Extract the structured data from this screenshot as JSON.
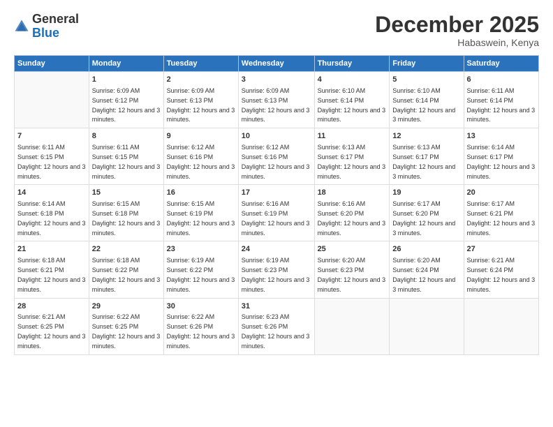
{
  "header": {
    "logo_general": "General",
    "logo_blue": "Blue",
    "month_title": "December 2025",
    "location": "Habaswein, Kenya"
  },
  "days_of_week": [
    "Sunday",
    "Monday",
    "Tuesday",
    "Wednesday",
    "Thursday",
    "Friday",
    "Saturday"
  ],
  "weeks": [
    [
      {
        "day": "",
        "sunrise": "",
        "sunset": "",
        "daylight": ""
      },
      {
        "day": "1",
        "sunrise": "Sunrise: 6:09 AM",
        "sunset": "Sunset: 6:12 PM",
        "daylight": "Daylight: 12 hours and 3 minutes."
      },
      {
        "day": "2",
        "sunrise": "Sunrise: 6:09 AM",
        "sunset": "Sunset: 6:13 PM",
        "daylight": "Daylight: 12 hours and 3 minutes."
      },
      {
        "day": "3",
        "sunrise": "Sunrise: 6:09 AM",
        "sunset": "Sunset: 6:13 PM",
        "daylight": "Daylight: 12 hours and 3 minutes."
      },
      {
        "day": "4",
        "sunrise": "Sunrise: 6:10 AM",
        "sunset": "Sunset: 6:14 PM",
        "daylight": "Daylight: 12 hours and 3 minutes."
      },
      {
        "day": "5",
        "sunrise": "Sunrise: 6:10 AM",
        "sunset": "Sunset: 6:14 PM",
        "daylight": "Daylight: 12 hours and 3 minutes."
      },
      {
        "day": "6",
        "sunrise": "Sunrise: 6:11 AM",
        "sunset": "Sunset: 6:14 PM",
        "daylight": "Daylight: 12 hours and 3 minutes."
      }
    ],
    [
      {
        "day": "7",
        "sunrise": "Sunrise: 6:11 AM",
        "sunset": "Sunset: 6:15 PM",
        "daylight": "Daylight: 12 hours and 3 minutes."
      },
      {
        "day": "8",
        "sunrise": "Sunrise: 6:11 AM",
        "sunset": "Sunset: 6:15 PM",
        "daylight": "Daylight: 12 hours and 3 minutes."
      },
      {
        "day": "9",
        "sunrise": "Sunrise: 6:12 AM",
        "sunset": "Sunset: 6:16 PM",
        "daylight": "Daylight: 12 hours and 3 minutes."
      },
      {
        "day": "10",
        "sunrise": "Sunrise: 6:12 AM",
        "sunset": "Sunset: 6:16 PM",
        "daylight": "Daylight: 12 hours and 3 minutes."
      },
      {
        "day": "11",
        "sunrise": "Sunrise: 6:13 AM",
        "sunset": "Sunset: 6:17 PM",
        "daylight": "Daylight: 12 hours and 3 minutes."
      },
      {
        "day": "12",
        "sunrise": "Sunrise: 6:13 AM",
        "sunset": "Sunset: 6:17 PM",
        "daylight": "Daylight: 12 hours and 3 minutes."
      },
      {
        "day": "13",
        "sunrise": "Sunrise: 6:14 AM",
        "sunset": "Sunset: 6:17 PM",
        "daylight": "Daylight: 12 hours and 3 minutes."
      }
    ],
    [
      {
        "day": "14",
        "sunrise": "Sunrise: 6:14 AM",
        "sunset": "Sunset: 6:18 PM",
        "daylight": "Daylight: 12 hours and 3 minutes."
      },
      {
        "day": "15",
        "sunrise": "Sunrise: 6:15 AM",
        "sunset": "Sunset: 6:18 PM",
        "daylight": "Daylight: 12 hours and 3 minutes."
      },
      {
        "day": "16",
        "sunrise": "Sunrise: 6:15 AM",
        "sunset": "Sunset: 6:19 PM",
        "daylight": "Daylight: 12 hours and 3 minutes."
      },
      {
        "day": "17",
        "sunrise": "Sunrise: 6:16 AM",
        "sunset": "Sunset: 6:19 PM",
        "daylight": "Daylight: 12 hours and 3 minutes."
      },
      {
        "day": "18",
        "sunrise": "Sunrise: 6:16 AM",
        "sunset": "Sunset: 6:20 PM",
        "daylight": "Daylight: 12 hours and 3 minutes."
      },
      {
        "day": "19",
        "sunrise": "Sunrise: 6:17 AM",
        "sunset": "Sunset: 6:20 PM",
        "daylight": "Daylight: 12 hours and 3 minutes."
      },
      {
        "day": "20",
        "sunrise": "Sunrise: 6:17 AM",
        "sunset": "Sunset: 6:21 PM",
        "daylight": "Daylight: 12 hours and 3 minutes."
      }
    ],
    [
      {
        "day": "21",
        "sunrise": "Sunrise: 6:18 AM",
        "sunset": "Sunset: 6:21 PM",
        "daylight": "Daylight: 12 hours and 3 minutes."
      },
      {
        "day": "22",
        "sunrise": "Sunrise: 6:18 AM",
        "sunset": "Sunset: 6:22 PM",
        "daylight": "Daylight: 12 hours and 3 minutes."
      },
      {
        "day": "23",
        "sunrise": "Sunrise: 6:19 AM",
        "sunset": "Sunset: 6:22 PM",
        "daylight": "Daylight: 12 hours and 3 minutes."
      },
      {
        "day": "24",
        "sunrise": "Sunrise: 6:19 AM",
        "sunset": "Sunset: 6:23 PM",
        "daylight": "Daylight: 12 hours and 3 minutes."
      },
      {
        "day": "25",
        "sunrise": "Sunrise: 6:20 AM",
        "sunset": "Sunset: 6:23 PM",
        "daylight": "Daylight: 12 hours and 3 minutes."
      },
      {
        "day": "26",
        "sunrise": "Sunrise: 6:20 AM",
        "sunset": "Sunset: 6:24 PM",
        "daylight": "Daylight: 12 hours and 3 minutes."
      },
      {
        "day": "27",
        "sunrise": "Sunrise: 6:21 AM",
        "sunset": "Sunset: 6:24 PM",
        "daylight": "Daylight: 12 hours and 3 minutes."
      }
    ],
    [
      {
        "day": "28",
        "sunrise": "Sunrise: 6:21 AM",
        "sunset": "Sunset: 6:25 PM",
        "daylight": "Daylight: 12 hours and 3 minutes."
      },
      {
        "day": "29",
        "sunrise": "Sunrise: 6:22 AM",
        "sunset": "Sunset: 6:25 PM",
        "daylight": "Daylight: 12 hours and 3 minutes."
      },
      {
        "day": "30",
        "sunrise": "Sunrise: 6:22 AM",
        "sunset": "Sunset: 6:26 PM",
        "daylight": "Daylight: 12 hours and 3 minutes."
      },
      {
        "day": "31",
        "sunrise": "Sunrise: 6:23 AM",
        "sunset": "Sunset: 6:26 PM",
        "daylight": "Daylight: 12 hours and 3 minutes."
      },
      {
        "day": "",
        "sunrise": "",
        "sunset": "",
        "daylight": ""
      },
      {
        "day": "",
        "sunrise": "",
        "sunset": "",
        "daylight": ""
      },
      {
        "day": "",
        "sunrise": "",
        "sunset": "",
        "daylight": ""
      }
    ]
  ]
}
